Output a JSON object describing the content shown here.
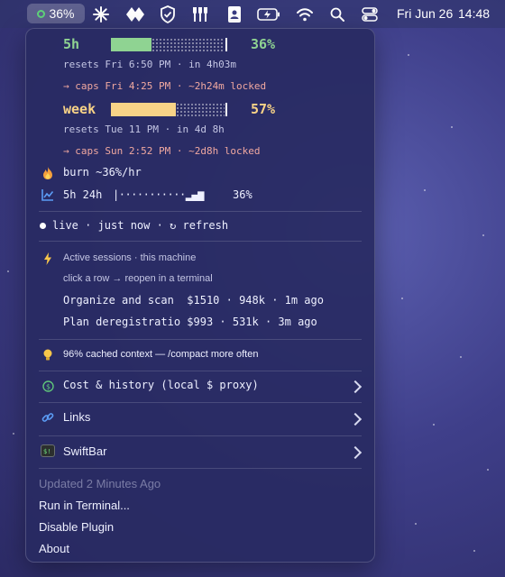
{
  "menubar": {
    "battery_label": "36%",
    "date": "Fri Jun 26",
    "time": "14:48",
    "icons": [
      "sparkle-icon",
      "diamond-icon",
      "shield-icon",
      "forks-icon",
      "contact-card-icon",
      "battery-icon",
      "wifi-icon",
      "search-icon",
      "control-center-icon"
    ]
  },
  "usage": {
    "session": {
      "label": "5h",
      "percent_label": "36%",
      "fraction": 0.36,
      "resets": "resets Fri 6:50 PM · in 4h03m",
      "caps": "→ caps Fri 4:25 PM · ~2h24m locked",
      "color": "#8fd392"
    },
    "week": {
      "label": "week",
      "percent_label": "57%",
      "fraction": 0.57,
      "resets": "resets Tue 11 PM · in 4d 8h",
      "caps": "→ caps Sun 2:52 PM · ~2d8h locked",
      "color": "#f8d387"
    },
    "burn": "burn ~36%/hr",
    "trend": {
      "label": "5h 24h",
      "sparkline": "|···········▂▄▆",
      "percent": "36%"
    }
  },
  "status": {
    "text": "live · just now · ↻ refresh"
  },
  "sessions": {
    "header": "Active sessions · this machine",
    "hint": "click a row → reopen in a terminal",
    "rows": [
      "Organize and scan  $1510 · 948k · 1m ago",
      "Plan deregistratio $993 · 531k · 3m ago"
    ]
  },
  "cache_note": "96% cached context — /compact more often",
  "menu": {
    "cost": "Cost & history (local $ proxy)",
    "links": "Links",
    "swiftbar": "SwiftBar"
  },
  "footer": {
    "updated": "Updated 2 Minutes Ago",
    "run": "Run in Terminal...",
    "disable": "Disable Plugin",
    "about": "About"
  },
  "colors": {
    "accent_green": "#8fd392",
    "accent_yellow": "#f8d387",
    "caps_red": "#f0a8a0",
    "text": "#eef0ff",
    "muted": "#c4c6e4"
  }
}
